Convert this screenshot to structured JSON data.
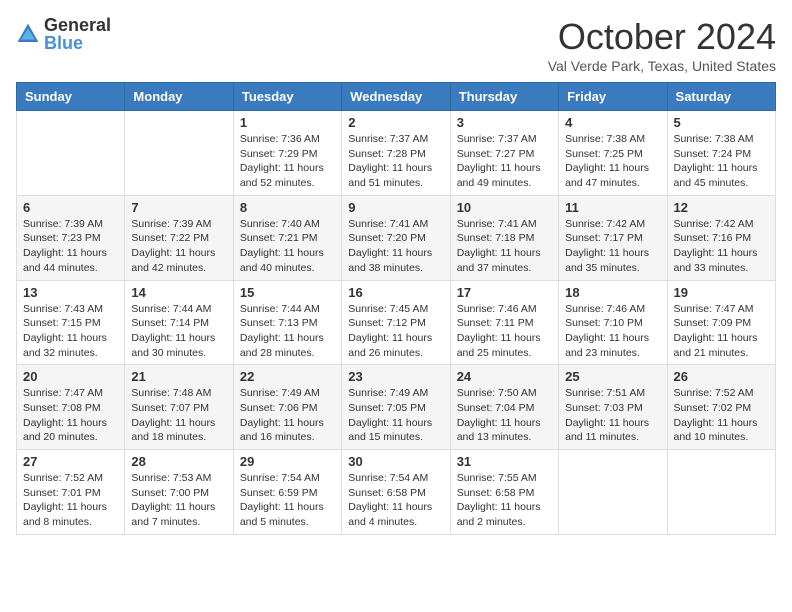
{
  "header": {
    "logo_general": "General",
    "logo_blue": "Blue",
    "title": "October 2024",
    "location": "Val Verde Park, Texas, United States"
  },
  "weekdays": [
    "Sunday",
    "Monday",
    "Tuesday",
    "Wednesday",
    "Thursday",
    "Friday",
    "Saturday"
  ],
  "weeks": [
    [
      {
        "day": "",
        "sunrise": "",
        "sunset": "",
        "daylight": ""
      },
      {
        "day": "",
        "sunrise": "",
        "sunset": "",
        "daylight": ""
      },
      {
        "day": "1",
        "sunrise": "Sunrise: 7:36 AM",
        "sunset": "Sunset: 7:29 PM",
        "daylight": "Daylight: 11 hours and 52 minutes."
      },
      {
        "day": "2",
        "sunrise": "Sunrise: 7:37 AM",
        "sunset": "Sunset: 7:28 PM",
        "daylight": "Daylight: 11 hours and 51 minutes."
      },
      {
        "day": "3",
        "sunrise": "Sunrise: 7:37 AM",
        "sunset": "Sunset: 7:27 PM",
        "daylight": "Daylight: 11 hours and 49 minutes."
      },
      {
        "day": "4",
        "sunrise": "Sunrise: 7:38 AM",
        "sunset": "Sunset: 7:25 PM",
        "daylight": "Daylight: 11 hours and 47 minutes."
      },
      {
        "day": "5",
        "sunrise": "Sunrise: 7:38 AM",
        "sunset": "Sunset: 7:24 PM",
        "daylight": "Daylight: 11 hours and 45 minutes."
      }
    ],
    [
      {
        "day": "6",
        "sunrise": "Sunrise: 7:39 AM",
        "sunset": "Sunset: 7:23 PM",
        "daylight": "Daylight: 11 hours and 44 minutes."
      },
      {
        "day": "7",
        "sunrise": "Sunrise: 7:39 AM",
        "sunset": "Sunset: 7:22 PM",
        "daylight": "Daylight: 11 hours and 42 minutes."
      },
      {
        "day": "8",
        "sunrise": "Sunrise: 7:40 AM",
        "sunset": "Sunset: 7:21 PM",
        "daylight": "Daylight: 11 hours and 40 minutes."
      },
      {
        "day": "9",
        "sunrise": "Sunrise: 7:41 AM",
        "sunset": "Sunset: 7:20 PM",
        "daylight": "Daylight: 11 hours and 38 minutes."
      },
      {
        "day": "10",
        "sunrise": "Sunrise: 7:41 AM",
        "sunset": "Sunset: 7:18 PM",
        "daylight": "Daylight: 11 hours and 37 minutes."
      },
      {
        "day": "11",
        "sunrise": "Sunrise: 7:42 AM",
        "sunset": "Sunset: 7:17 PM",
        "daylight": "Daylight: 11 hours and 35 minutes."
      },
      {
        "day": "12",
        "sunrise": "Sunrise: 7:42 AM",
        "sunset": "Sunset: 7:16 PM",
        "daylight": "Daylight: 11 hours and 33 minutes."
      }
    ],
    [
      {
        "day": "13",
        "sunrise": "Sunrise: 7:43 AM",
        "sunset": "Sunset: 7:15 PM",
        "daylight": "Daylight: 11 hours and 32 minutes."
      },
      {
        "day": "14",
        "sunrise": "Sunrise: 7:44 AM",
        "sunset": "Sunset: 7:14 PM",
        "daylight": "Daylight: 11 hours and 30 minutes."
      },
      {
        "day": "15",
        "sunrise": "Sunrise: 7:44 AM",
        "sunset": "Sunset: 7:13 PM",
        "daylight": "Daylight: 11 hours and 28 minutes."
      },
      {
        "day": "16",
        "sunrise": "Sunrise: 7:45 AM",
        "sunset": "Sunset: 7:12 PM",
        "daylight": "Daylight: 11 hours and 26 minutes."
      },
      {
        "day": "17",
        "sunrise": "Sunrise: 7:46 AM",
        "sunset": "Sunset: 7:11 PM",
        "daylight": "Daylight: 11 hours and 25 minutes."
      },
      {
        "day": "18",
        "sunrise": "Sunrise: 7:46 AM",
        "sunset": "Sunset: 7:10 PM",
        "daylight": "Daylight: 11 hours and 23 minutes."
      },
      {
        "day": "19",
        "sunrise": "Sunrise: 7:47 AM",
        "sunset": "Sunset: 7:09 PM",
        "daylight": "Daylight: 11 hours and 21 minutes."
      }
    ],
    [
      {
        "day": "20",
        "sunrise": "Sunrise: 7:47 AM",
        "sunset": "Sunset: 7:08 PM",
        "daylight": "Daylight: 11 hours and 20 minutes."
      },
      {
        "day": "21",
        "sunrise": "Sunrise: 7:48 AM",
        "sunset": "Sunset: 7:07 PM",
        "daylight": "Daylight: 11 hours and 18 minutes."
      },
      {
        "day": "22",
        "sunrise": "Sunrise: 7:49 AM",
        "sunset": "Sunset: 7:06 PM",
        "daylight": "Daylight: 11 hours and 16 minutes."
      },
      {
        "day": "23",
        "sunrise": "Sunrise: 7:49 AM",
        "sunset": "Sunset: 7:05 PM",
        "daylight": "Daylight: 11 hours and 15 minutes."
      },
      {
        "day": "24",
        "sunrise": "Sunrise: 7:50 AM",
        "sunset": "Sunset: 7:04 PM",
        "daylight": "Daylight: 11 hours and 13 minutes."
      },
      {
        "day": "25",
        "sunrise": "Sunrise: 7:51 AM",
        "sunset": "Sunset: 7:03 PM",
        "daylight": "Daylight: 11 hours and 11 minutes."
      },
      {
        "day": "26",
        "sunrise": "Sunrise: 7:52 AM",
        "sunset": "Sunset: 7:02 PM",
        "daylight": "Daylight: 11 hours and 10 minutes."
      }
    ],
    [
      {
        "day": "27",
        "sunrise": "Sunrise: 7:52 AM",
        "sunset": "Sunset: 7:01 PM",
        "daylight": "Daylight: 11 hours and 8 minutes."
      },
      {
        "day": "28",
        "sunrise": "Sunrise: 7:53 AM",
        "sunset": "Sunset: 7:00 PM",
        "daylight": "Daylight: 11 hours and 7 minutes."
      },
      {
        "day": "29",
        "sunrise": "Sunrise: 7:54 AM",
        "sunset": "Sunset: 6:59 PM",
        "daylight": "Daylight: 11 hours and 5 minutes."
      },
      {
        "day": "30",
        "sunrise": "Sunrise: 7:54 AM",
        "sunset": "Sunset: 6:58 PM",
        "daylight": "Daylight: 11 hours and 4 minutes."
      },
      {
        "day": "31",
        "sunrise": "Sunrise: 7:55 AM",
        "sunset": "Sunset: 6:58 PM",
        "daylight": "Daylight: 11 hours and 2 minutes."
      },
      {
        "day": "",
        "sunrise": "",
        "sunset": "",
        "daylight": ""
      },
      {
        "day": "",
        "sunrise": "",
        "sunset": "",
        "daylight": ""
      }
    ]
  ]
}
